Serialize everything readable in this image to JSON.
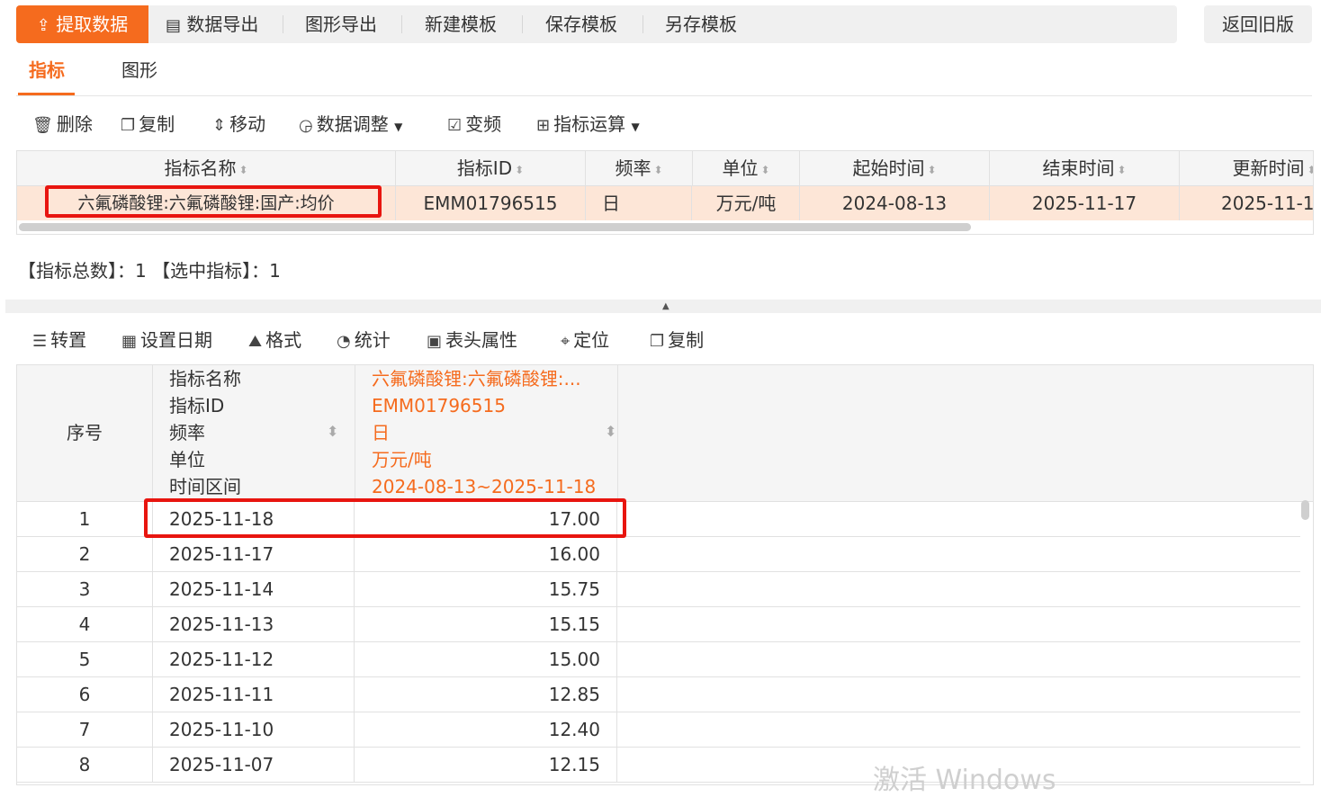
{
  "toolbar": {
    "extract": "提取数据",
    "export_data": "数据导出",
    "export_chart": "图形导出",
    "new_template": "新建模板",
    "save_template": "保存模板",
    "save_as_template": "另存模板",
    "back_old": "返回旧版"
  },
  "tabs": {
    "indicator": "指标",
    "chart": "图形"
  },
  "actions": {
    "delete": "删除",
    "copy": "复制",
    "move": "移动",
    "adjust": "数据调整",
    "freq": "变频",
    "calc": "指标运算"
  },
  "indicator_table": {
    "headers": [
      "指标名称",
      "指标ID",
      "频率",
      "单位",
      "起始时间",
      "结束时间",
      "更新时间"
    ],
    "row": [
      "六氟磷酸锂:六氟磷酸锂:国产:均价",
      "EMM01796515",
      "日",
      "万元/吨",
      "2024-08-13",
      "2025-11-17",
      "2025-11-1"
    ]
  },
  "summary": {
    "text": "【指标总数】：1 【选中指标】：1"
  },
  "data_toolbar": {
    "transpose": "转置",
    "set_date": "设置日期",
    "format": "格式",
    "stats": "统计",
    "header_props": "表头属性",
    "locate": "定位",
    "copy": "复制"
  },
  "data_table": {
    "index_header": "序号",
    "meta_labels": [
      "指标名称",
      "指标ID",
      "频率",
      "单位",
      "时间区间"
    ],
    "meta_values": [
      "六氟磷酸锂:六氟磷酸锂:...",
      "EMM01796515",
      "日",
      "万元/吨",
      "2024-08-13~2025-11-18"
    ],
    "rows": [
      {
        "idx": "1",
        "date": "2025-11-18",
        "value": "17.00"
      },
      {
        "idx": "2",
        "date": "2025-11-17",
        "value": "16.00"
      },
      {
        "idx": "3",
        "date": "2025-11-14",
        "value": "15.75"
      },
      {
        "idx": "4",
        "date": "2025-11-13",
        "value": "15.15"
      },
      {
        "idx": "5",
        "date": "2025-11-12",
        "value": "15.00"
      },
      {
        "idx": "6",
        "date": "2025-11-11",
        "value": "12.85"
      },
      {
        "idx": "7",
        "date": "2025-11-10",
        "value": "12.40"
      },
      {
        "idx": "8",
        "date": "2025-11-07",
        "value": "12.15"
      }
    ]
  },
  "watermark": "激活 Windows",
  "colors": {
    "accent": "#f56b1e",
    "highlight": "#e8150f",
    "selected_row": "#fde6d7"
  }
}
